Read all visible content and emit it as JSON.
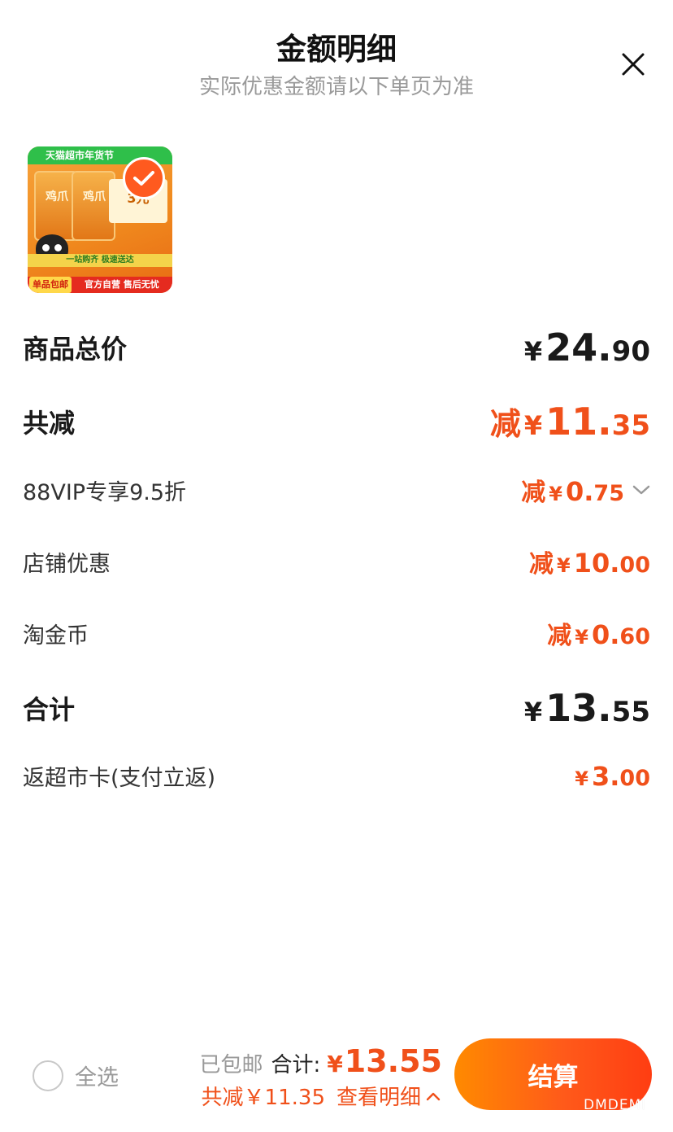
{
  "header": {
    "title": "金额明细",
    "subtitle": "实际优惠金额请以下单页为准"
  },
  "product": {
    "image_top_text": "天猫超市年货节",
    "image_bag_text": "鸡爪",
    "image_card_text": "3元",
    "image_mid_text": "一站购齐 极速送达",
    "image_badge_text": "单品包邮",
    "image_bottom_text": "官方自营 售后无忧",
    "selected": true
  },
  "rows": [
    {
      "label": "商品总价",
      "prefix": "",
      "yen": "¥",
      "int": "24.",
      "dec": "90",
      "color": "#1a1a1a"
    },
    {
      "label": "共减",
      "prefix": "减",
      "yen": "¥",
      "int": "11.",
      "dec": "35",
      "color": "#f0501a"
    },
    {
      "label": "88VIP专享9.5折",
      "prefix": "减",
      "yen": "¥",
      "int": "0.",
      "dec": "75",
      "color": "#f0501a",
      "expand_icon": "chevron-down-icon"
    },
    {
      "label": "店铺优惠",
      "prefix": "减",
      "yen": "¥",
      "int": "10.",
      "dec": "00",
      "color": "#f0501a"
    },
    {
      "label": "淘金币",
      "prefix": "减",
      "yen": "¥",
      "int": "0.",
      "dec": "60",
      "color": "#f0501a"
    },
    {
      "label": "合计",
      "prefix": "",
      "yen": "¥",
      "int": "13.",
      "dec": "55",
      "color": "#1a1a1a"
    },
    {
      "label": "返超市卡(支付立返)",
      "prefix": "",
      "yen": "¥",
      "int": "3.",
      "dec": "00",
      "color": "#f0501a"
    }
  ],
  "footer": {
    "select_all_label": "全选",
    "shipping_text": "已包邮",
    "total_label": "合计:",
    "total_yen": "¥",
    "total_value": "13.55",
    "reduce_text": "共减￥11.35",
    "detail_link": "查看明细",
    "checkout_label": "结算"
  },
  "watermark": "DMDEMI",
  "colors": {
    "accent": "#f0501a",
    "checkout_start": "#ff8a00",
    "checkout_end": "#ff3d12"
  }
}
